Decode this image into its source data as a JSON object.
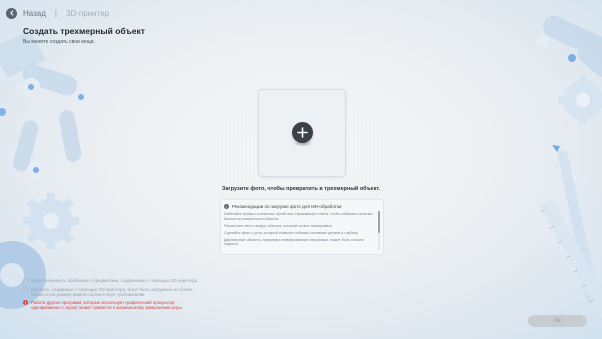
{
  "header": {
    "back_label": "Назад",
    "separator": "|",
    "crumb": "3D-принтер"
  },
  "page": {
    "title": "Создать трехмерный объект",
    "subtitle": "Вы можете создать свои вещи."
  },
  "upload": {
    "hint": "Загрузите фото, чтобы превратить в трехмерный объект."
  },
  "recommendations": {
    "title": "Рекомендации по загрузке фото для ИИ-обработки",
    "items": [
      "Избегайте прямых солнечных лучей или отражающего света, чтобы избежать сильных бликов на поверхности объекта.",
      "Расчистите место вокруг объекта, который хотите сканировать.",
      "Сделайте фото с угла, который позволит поймать основные детали и глубину.",
      "Двухмерные объекты, например анимированные персонажи, может быть сложно поднять."
    ]
  },
  "notes": [
    {
      "type": "info",
      "text": "Могут возникнуть проблемы с предметами, созданными с помощью 3D-принтера."
    },
    {
      "type": "info",
      "text": "Объекты, созданные с помощью 3D-принтера, могут быть загружены не более, только если размер файла соответствует требованиям."
    },
    {
      "type": "warning",
      "text": "Работа других программ, которые использует графический процессор одновременно с игрой, может привести к аномальному завершению игры."
    }
  ],
  "footer": {
    "ok_label": "Ок"
  },
  "colors": {
    "background": "#edf0f3",
    "accent_blue": "#8fb4d8",
    "warning": "#d9423c",
    "disabled_button": "#c7ccd1"
  }
}
